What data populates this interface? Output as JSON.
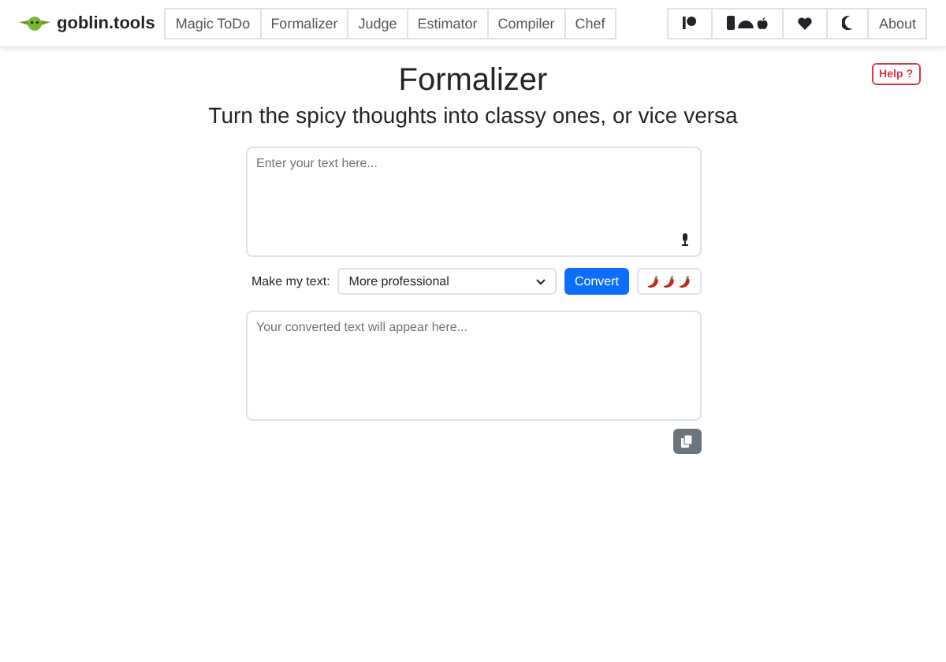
{
  "brand": {
    "name": "goblin.tools"
  },
  "nav": [
    {
      "label": "Magic ToDo",
      "selected": false
    },
    {
      "label": "Formalizer",
      "selected": false
    },
    {
      "label": "Judge",
      "selected": false
    },
    {
      "label": "Estimator",
      "selected": false
    },
    {
      "label": "Compiler",
      "selected": false
    },
    {
      "label": "Chef",
      "selected": false
    }
  ],
  "nav_right": [
    {
      "kind": "patreon"
    },
    {
      "kind": "apps"
    },
    {
      "kind": "heart"
    },
    {
      "kind": "moon"
    },
    {
      "kind": "text",
      "label": "About"
    }
  ],
  "help": {
    "label": "Help",
    "icon": "?"
  },
  "title": "Formalizer",
  "subtitle": "Turn the spicy thoughts into classy ones, or vice versa",
  "input": {
    "placeholder": "Enter your text here..."
  },
  "controls": {
    "label": "Make my text:",
    "select": "More professional",
    "convert": "Convert"
  },
  "output": {
    "placeholder": "Your converted text will appear here..."
  }
}
